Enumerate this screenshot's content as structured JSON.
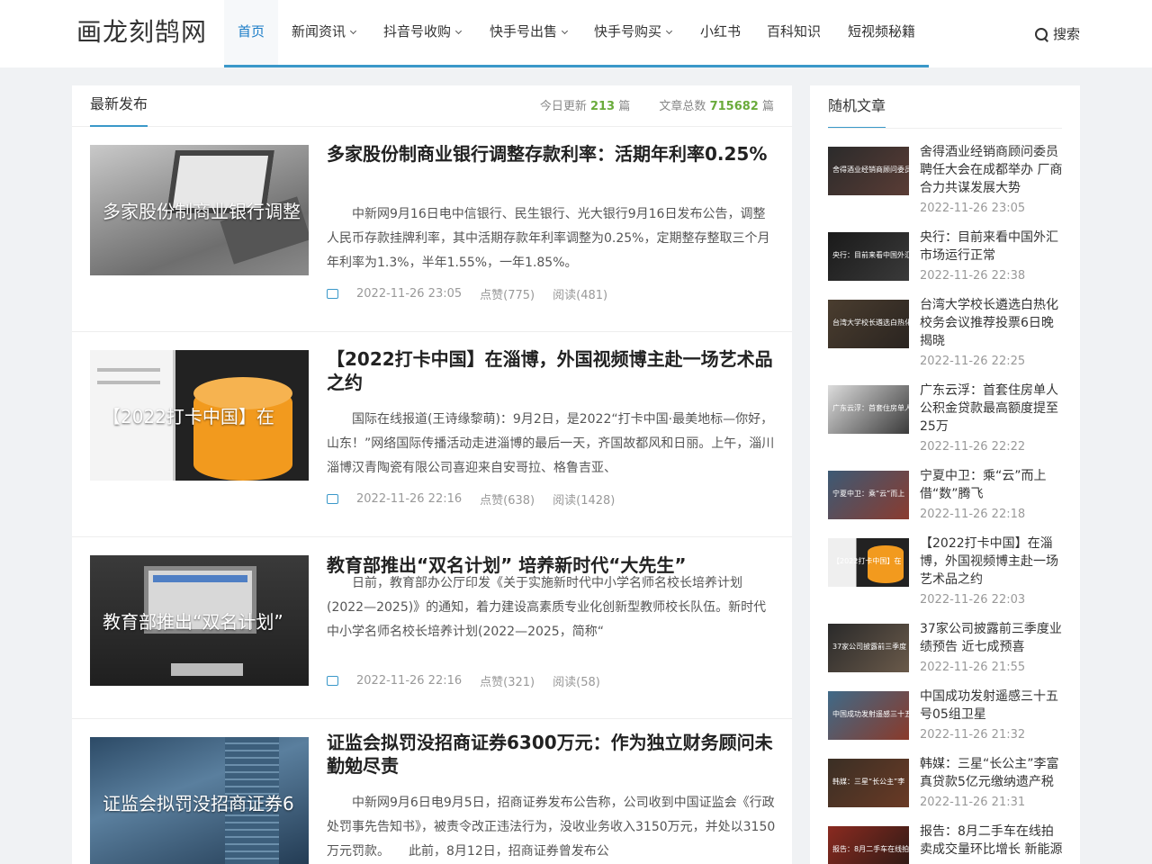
{
  "site": {
    "logo": "画龙刻鹄网"
  },
  "nav": {
    "items": [
      {
        "label": "首页",
        "dropdown": false,
        "active": true
      },
      {
        "label": "新闻资讯",
        "dropdown": true,
        "active": false
      },
      {
        "label": "抖音号收购",
        "dropdown": true,
        "active": false
      },
      {
        "label": "快手号出售",
        "dropdown": true,
        "active": false
      },
      {
        "label": "快手号购买",
        "dropdown": true,
        "active": false
      },
      {
        "label": "小红书",
        "dropdown": false,
        "active": false
      },
      {
        "label": "百科知识",
        "dropdown": false,
        "active": false
      },
      {
        "label": "短视频秘籍",
        "dropdown": false,
        "active": false
      }
    ],
    "search_label": "搜索",
    "accent_color": "#3a98c9"
  },
  "main": {
    "title": "最新发布",
    "today_label": "今日更新",
    "today_count": "213",
    "total_label": "文章总数",
    "total_count": "715682",
    "unit": "篇",
    "posts": [
      {
        "title": "多家股份制商业银行调整存款利率：活期年利率0.25%",
        "thumb_caption": "多家股份制商业银行调整",
        "excerpt": "中新网9月16日电中信银行、民生银行、光大银行9月16日发布公告，调整人民币存款挂牌利率，其中活期存款年利率调整为0.25%，定期整存整取三个月年利率为1.3%，半年1.55%，一年1.85%。",
        "date": "2022-11-26 23:05",
        "likes": "点赞(775)",
        "reads": "阅读(481)"
      },
      {
        "title": "【2022打卡中国】在淄博，外国视频博主赴一场艺术品之约",
        "thumb_caption": "【2022打卡中国】在",
        "excerpt": "国际在线报道(王诗缘黎萌)：9月2日，是2022“打卡中国·最美地标—你好，山东！”网络国际传播活动走进淄博的最后一天，齐国故都风和日丽。上午，淄川淄博汉青陶瓷有限公司喜迎来自安哥拉、格鲁吉亚、",
        "date": "2022-11-26 22:16",
        "likes": "点赞(638)",
        "reads": "阅读(1428)"
      },
      {
        "title": "教育部推出“双名计划” 培养新时代“大先生”",
        "thumb_caption": "教育部推出“双名计划”",
        "excerpt": "日前，教育部办公厅印发《关于实施新时代中小学名师名校长培养计划(2022—2025)》的通知，着力建设高素质专业化创新型教师校长队伍。新时代中小学名师名校长培养计划(2022—2025，简称“",
        "date": "2022-11-26 22:16",
        "likes": "点赞(321)",
        "reads": "阅读(58)"
      },
      {
        "title": "证监会拟罚没招商证券6300万元：作为独立财务顾问未勤勉尽责",
        "thumb_caption": "证监会拟罚没招商证券6",
        "excerpt": "中新网9月6日电9月5日，招商证券发布公告称，公司收到中国证监会《行政处罚事先告知书》，被责令改正违法行为，没收业务收入3150万元，并处以3150万元罚款。　　此前，8月12日，招商证券曾发布公",
        "date": "",
        "likes": "",
        "reads": ""
      }
    ]
  },
  "sidebar": {
    "title": "随机文章",
    "items": [
      {
        "title": "舍得酒业经销商顾问委员聘任大会在成都举办 厂商合力共谋发展大势",
        "caption": "舍得酒业经销商顾问委员",
        "date": "2022-11-26 23:05"
      },
      {
        "title": "央行：目前来看中国外汇市场运行正常",
        "caption": "央行：目前来看中国外汇",
        "date": "2022-11-26 22:38"
      },
      {
        "title": "台湾大学校长遴选白热化 校务会议推荐投票6日晚揭晓",
        "caption": "台湾大学校长遴选白热化",
        "date": "2022-11-26 22:25"
      },
      {
        "title": "广东云浮：首套住房单人公积金贷款最高额度提至25万",
        "caption": "广东云浮：首套住房单人",
        "date": "2022-11-26 22:22"
      },
      {
        "title": "宁夏中卫：乘“云”而上借“数”腾飞",
        "caption": "宁夏中卫：乘“云”而上",
        "date": "2022-11-26 22:18"
      },
      {
        "title": "【2022打卡中国】在淄博，外国视频博主赴一场艺术品之约",
        "caption": "【2022打卡中国】在",
        "date": "2022-11-26 22:03"
      },
      {
        "title": "37家公司披露前三季度业绩预告 近七成预喜",
        "caption": "37家公司披露前三季度",
        "date": "2022-11-26 21:55"
      },
      {
        "title": "中国成功发射遥感三十五号05组卫星",
        "caption": "中国成功发射遥感三十五",
        "date": "2022-11-26 21:32"
      },
      {
        "title": "韩媒：三星“长公主”李富真贷款5亿元缴纳遗产税",
        "caption": "韩媒：三星“长公主”李",
        "date": "2022-11-26 21:31"
      },
      {
        "title": "报告：8月二手车在线拍卖成交量环比增长 新能源",
        "caption": "报告：8月二手车在线拍",
        "date": ""
      }
    ]
  }
}
